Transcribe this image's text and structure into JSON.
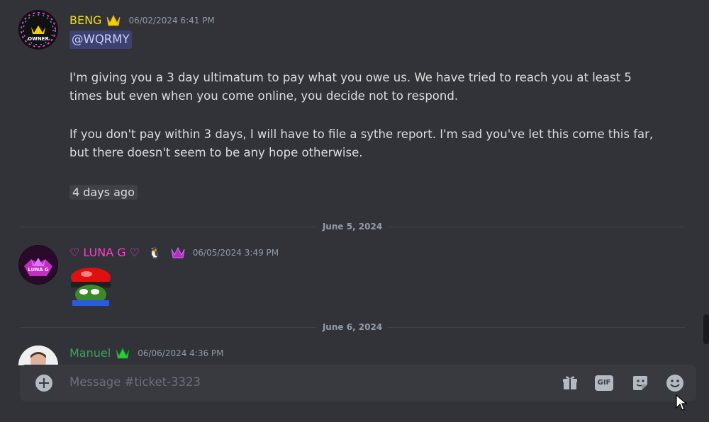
{
  "channel": "ticket-3323",
  "colors": {
    "owner": "#f0e000",
    "luna": "#ff3fd0",
    "manuel": "#3ba55d",
    "background": "#313338"
  },
  "messages": [
    {
      "author": "BENG",
      "timestamp": "06/02/2024 6:41 PM",
      "avatar_text": "OWNER",
      "mention": "@WQRMY",
      "paragraphs": [
        "I'm giving you a 3 day ultimatum to pay what you owe us. We have tried to reach you at least 5 times but even when you come online, you decide not to respond.",
        "If you don't pay within 3 days, I will have to file a sythe report. I'm sad you've let this come this far, but there doesn't seem to be any hope otherwise."
      ],
      "relative_time": "4 days ago"
    },
    {
      "author": "♡ LUNA G ♡",
      "timestamp": "06/05/2024 3:49 PM",
      "avatar_text": "LUNA G",
      "emoji": "pepe-siren-emoji"
    },
    {
      "author": "Manuel",
      "timestamp": "06/06/2024 4:36 PM"
    }
  ],
  "dividers": [
    "June 5, 2024",
    "June 6, 2024"
  ],
  "composer": {
    "placeholder": "Message #ticket-3323",
    "icons": [
      "add-icon",
      "gift-icon",
      "gif-icon",
      "sticker-icon",
      "emoji-icon"
    ],
    "gif_label": "GIF"
  }
}
